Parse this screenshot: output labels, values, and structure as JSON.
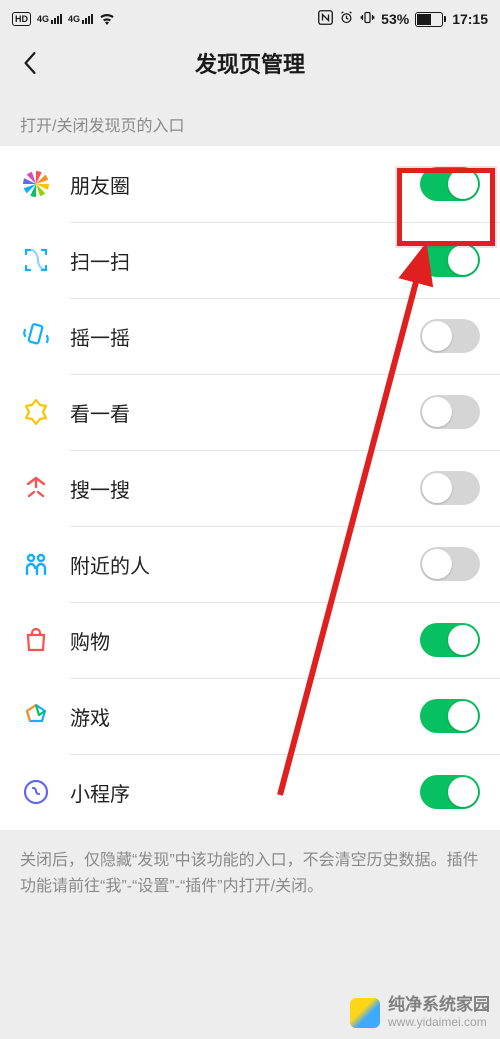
{
  "statusbar": {
    "hd": "HD",
    "net1": "4G",
    "net2": "4G",
    "nfc": "N",
    "alarm": "⏰",
    "vibrate": "📳",
    "battery_pct": "53%",
    "time": "17:15"
  },
  "nav": {
    "title": "发现页管理"
  },
  "section_label": "打开/关闭发现页的入口",
  "items": [
    {
      "key": "moments",
      "label": "朋友圈",
      "on": true,
      "icon": "moments-icon"
    },
    {
      "key": "scan",
      "label": "扫一扫",
      "on": true,
      "icon": "scan-icon"
    },
    {
      "key": "shake",
      "label": "摇一摇",
      "on": false,
      "icon": "shake-icon"
    },
    {
      "key": "topstories",
      "label": "看一看",
      "on": false,
      "icon": "topstories-icon"
    },
    {
      "key": "search",
      "label": "搜一搜",
      "on": false,
      "icon": "search-icon"
    },
    {
      "key": "nearby",
      "label": "附近的人",
      "on": false,
      "icon": "nearby-icon"
    },
    {
      "key": "shopping",
      "label": "购物",
      "on": true,
      "icon": "shopping-icon"
    },
    {
      "key": "games",
      "label": "游戏",
      "on": true,
      "icon": "games-icon"
    },
    {
      "key": "miniprogram",
      "label": "小程序",
      "on": true,
      "icon": "miniprogram-icon"
    }
  ],
  "hint": "关闭后，仅隐藏“发现”中该功能的入口，不会清空历史数据。插件功能请前往“我”-“设置”-“插件”内打开/关闭。",
  "annotation": {
    "highlight_target": "items.0"
  },
  "watermark": {
    "name": "纯净系统家园",
    "url": "www.yidaimei.com"
  }
}
